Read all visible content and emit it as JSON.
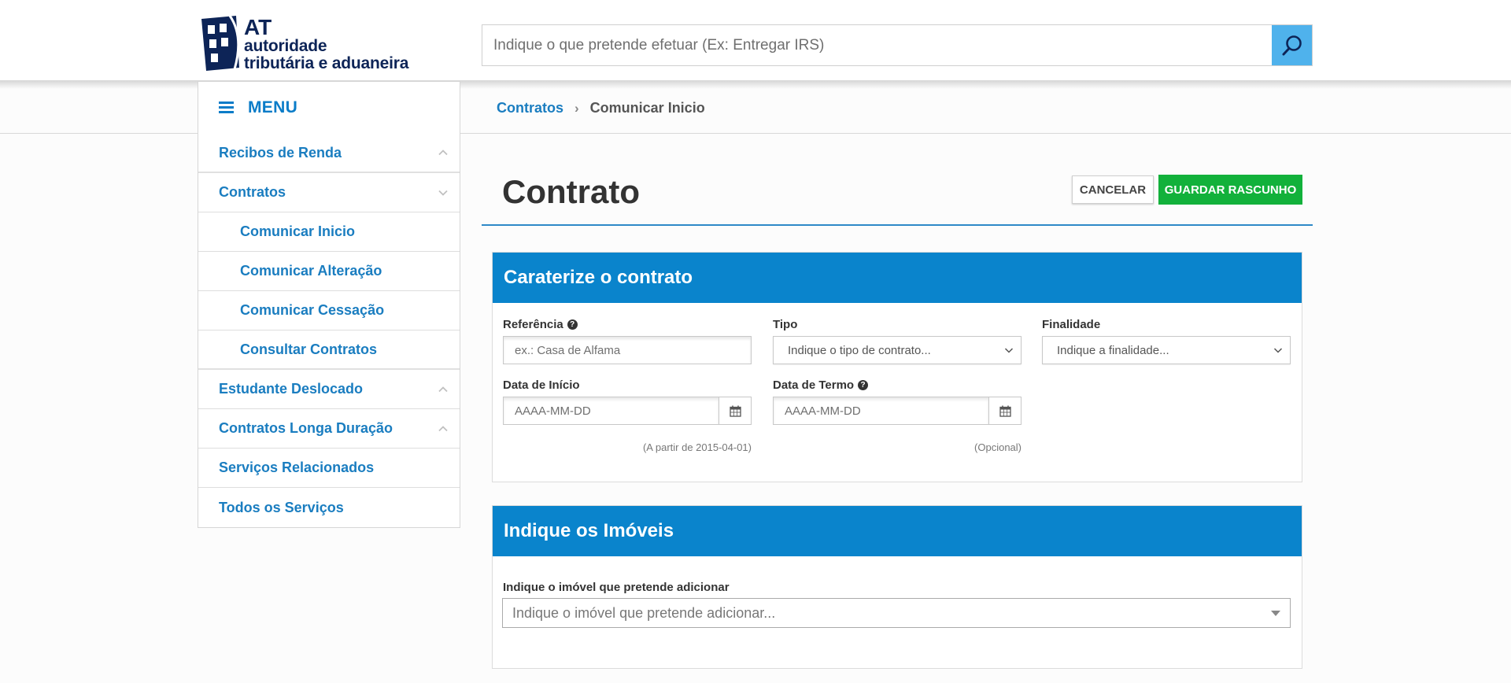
{
  "header": {
    "logo": {
      "line1": "AT",
      "line2": "autoridade",
      "line3": "tributária e aduaneira"
    },
    "search": {
      "placeholder": "Indique o que pretende efetuar (Ex: Entregar IRS)",
      "icon": "search-icon"
    }
  },
  "menu": {
    "label": "MENU",
    "icon": "hamburger-icon"
  },
  "breadcrumb": {
    "parent": "Contratos",
    "separator": "›",
    "current": "Comunicar Inicio"
  },
  "sidebar": {
    "items": [
      {
        "label": "Recibos de Renda",
        "chevron": "chevron-up-icon"
      },
      {
        "label": "Contratos",
        "chevron": "chevron-down-icon"
      },
      {
        "label": "Comunicar Inicio"
      },
      {
        "label": "Comunicar Alteração"
      },
      {
        "label": "Comunicar Cessação"
      },
      {
        "label": "Consultar Contratos"
      },
      {
        "label": "Estudante Deslocado",
        "chevron": "chevron-up-icon"
      },
      {
        "label": "Contratos Longa Duração",
        "chevron": "chevron-up-icon"
      },
      {
        "label": "Serviços Relacionados"
      },
      {
        "label": "Todos os Serviços"
      }
    ]
  },
  "main": {
    "title": "Contrato",
    "cancel_label": "CANCELAR",
    "save_label": "GUARDAR RASCUNHO",
    "section1": {
      "title": "Caraterize o contrato",
      "referencia": {
        "label": "Referência",
        "placeholder": "ex.: Casa de Alfama"
      },
      "tipo": {
        "label": "Tipo",
        "value": "Indique o tipo de contrato..."
      },
      "finalidade": {
        "label": "Finalidade",
        "value": "Indique a finalidade..."
      },
      "data_inicio": {
        "label": "Data de Início",
        "placeholder": "AAAA-MM-DD",
        "hint": "(A partir de 2015-04-01)"
      },
      "data_termo": {
        "label": "Data de Termo",
        "placeholder": "AAAA-MM-DD",
        "hint": "(Opcional)"
      }
    },
    "section2": {
      "title": "Indique os Imóveis",
      "imovel": {
        "label": "Indique o imóvel que pretende adicionar",
        "value": "Indique o imóvel que pretende adicionar..."
      }
    }
  },
  "colors": {
    "accent": "#0a84cc",
    "link": "#1a7dc0",
    "save": "#12b13b",
    "search_btn": "#4fb2ec",
    "logo": "#0d2457"
  }
}
